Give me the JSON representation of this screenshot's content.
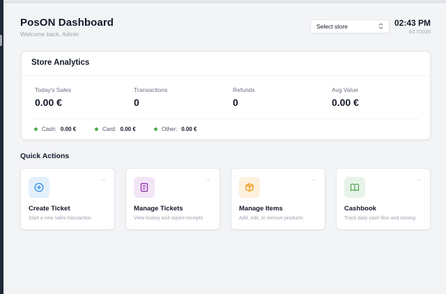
{
  "header": {
    "title": "PosON Dashboard",
    "subtitle": "Welcome back, Admin",
    "store_select": "Select store",
    "time": "02:43 PM",
    "date": "6/17/2026"
  },
  "analytics": {
    "title": "Store Analytics",
    "stats": [
      {
        "label": "Today's Sales",
        "value": "0.00 €"
      },
      {
        "label": "Transactions",
        "value": "0"
      },
      {
        "label": "Refunds",
        "value": "0"
      },
      {
        "label": "Avg Value",
        "value": "0.00 €"
      }
    ],
    "breakdown": [
      {
        "label": "Cash:",
        "value": "0.00 €"
      },
      {
        "label": "Card:",
        "value": "0.00 €"
      },
      {
        "label": "Other:",
        "value": "0.00 €"
      }
    ]
  },
  "quick_actions": {
    "title": "Quick Actions",
    "cards": [
      {
        "title": "Create Ticket",
        "desc": "Start a new sales transaction",
        "icon": "plus-circle-icon",
        "color": "#1e88e5",
        "bg": "#e3f0fb"
      },
      {
        "title": "Manage Tickets",
        "desc": "View history and reprint receipts",
        "icon": "receipt-icon",
        "color": "#8e24aa",
        "bg": "#f2e6f6"
      },
      {
        "title": "Manage Items",
        "desc": "Add, edit, or remove products",
        "icon": "package-icon",
        "color": "#ef8f00",
        "bg": "#fdf0dc"
      },
      {
        "title": "Cashbook",
        "desc": "Track daily cash flow and closing",
        "icon": "book-icon",
        "color": "#43a047",
        "bg": "#e7f3e8"
      }
    ]
  },
  "colors": {
    "accent_green": "#4caf50"
  }
}
